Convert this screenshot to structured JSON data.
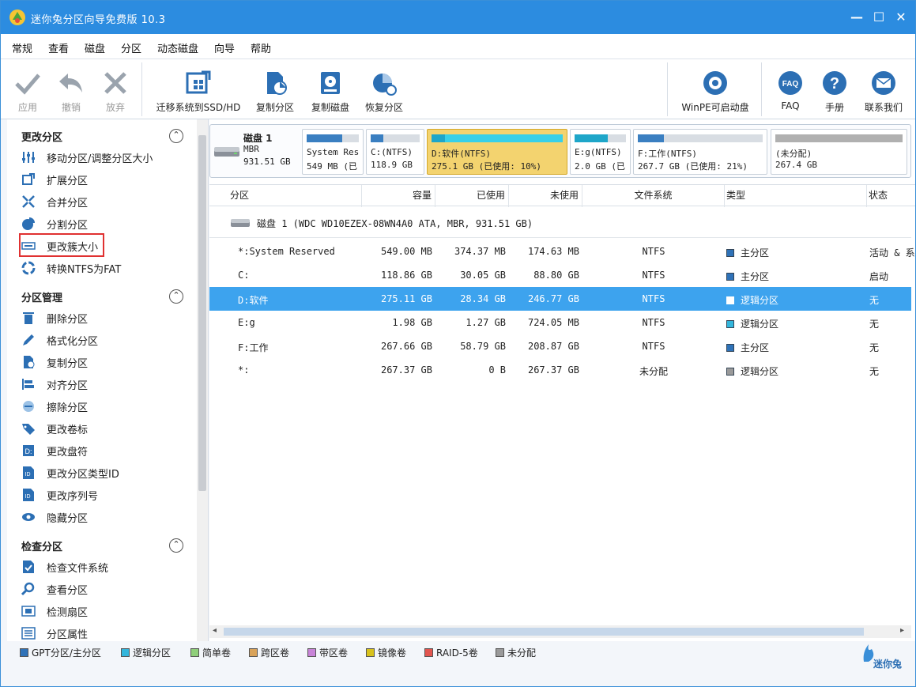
{
  "window": {
    "title": "迷你兔分区向导免费版 10.3",
    "minimize": "—",
    "maximize": "☐",
    "close": "✕"
  },
  "menu": [
    "常规",
    "查看",
    "磁盘",
    "分区",
    "动态磁盘",
    "向导",
    "帮助"
  ],
  "toolbar": {
    "apply": "应用",
    "undo": "撤销",
    "discard": "放弃",
    "migrate": "迁移系统到SSD/HD",
    "copy_partition": "复制分区",
    "copy_disk": "复制磁盘",
    "recover_partition": "恢复分区",
    "winpe": "WinPE可启动盘",
    "faq": "FAQ",
    "manual": "手册",
    "contact": "联系我们"
  },
  "sidebar": {
    "sections": [
      {
        "title": "更改分区",
        "items": [
          "移动分区/调整分区大小",
          "扩展分区",
          "合并分区",
          "分割分区",
          "更改簇大小",
          "转换NTFS为FAT"
        ]
      },
      {
        "title": "分区管理",
        "items": [
          "删除分区",
          "格式化分区",
          "复制分区",
          "对齐分区",
          "擦除分区",
          "更改卷标",
          "更改盘符",
          "更改分区类型ID",
          "更改序列号",
          "隐藏分区"
        ]
      },
      {
        "title": "检查分区",
        "items": [
          "检查文件系统",
          "查看分区",
          "检测扇区",
          "分区属性"
        ]
      }
    ],
    "toggle": "⌃"
  },
  "diskmap": {
    "disk": {
      "name": "磁盘 1",
      "type": "MBR",
      "size": "931.51 GB"
    },
    "partitions": [
      {
        "l1": "System Res",
        "l2": "549 MB (已",
        "fill": 0.68,
        "color": "#3a7fc1"
      },
      {
        "l1": "C:(NTFS)",
        "l2": "118.9 GB",
        "fill": 0.25,
        "color": "#3a7fc1"
      },
      {
        "l1": "D:软件(NTFS)",
        "l2": "275.1 GB (已使用: 10%)",
        "fill": 0.1,
        "color": "#1ea6c9"
      },
      {
        "l1": "E:g(NTFS)",
        "l2": "2.0 GB (已",
        "fill": 0.64,
        "color": "#1ea6c9"
      },
      {
        "l1": "F:工作(NTFS)",
        "l2": "267.7 GB (已使用: 21%)",
        "fill": 0.21,
        "color": "#3a7fc1"
      },
      {
        "l1": "(未分配)",
        "l2": "267.4 GB",
        "fill": 1.0,
        "color": "#b0b0b0"
      }
    ]
  },
  "table": {
    "headers": [
      "分区",
      "容量",
      "已使用",
      "未使用",
      "文件系统",
      "类型",
      "状态"
    ],
    "disk_row": "磁盘 1 (WDC WD10EZEX-08WN4A0 ATA, MBR, 931.51 GB)",
    "rows": [
      {
        "partition": "*:System Reserved",
        "capacity": "549.00 MB",
        "used": "374.37 MB",
        "unused": "174.63 MB",
        "fs": "NTFS",
        "type": "主分区",
        "status": "活动 & 系",
        "type_color": "#2f72b8"
      },
      {
        "partition": "C:",
        "capacity": "118.86 GB",
        "used": "30.05 GB",
        "unused": "88.80 GB",
        "fs": "NTFS",
        "type": "主分区",
        "status": "启动",
        "type_color": "#2f72b8"
      },
      {
        "partition": "D:软件",
        "capacity": "275.11 GB",
        "used": "28.34 GB",
        "unused": "246.77 GB",
        "fs": "NTFS",
        "type": "逻辑分区",
        "status": "无",
        "type_color": "#33b6dc"
      },
      {
        "partition": "E:g",
        "capacity": "1.98 GB",
        "used": "1.27 GB",
        "unused": "724.05 MB",
        "fs": "NTFS",
        "type": "逻辑分区",
        "status": "无",
        "type_color": "#33b6dc"
      },
      {
        "partition": "F:工作",
        "capacity": "267.66 GB",
        "used": "58.79 GB",
        "unused": "208.87 GB",
        "fs": "NTFS",
        "type": "主分区",
        "status": "无",
        "type_color": "#2f72b8"
      },
      {
        "partition": "*:",
        "capacity": "267.37 GB",
        "used": "0 B",
        "unused": "267.37 GB",
        "fs": "未分配",
        "type": "逻辑分区",
        "status": "无",
        "type_color": "#9a9a9a"
      }
    ]
  },
  "legend": [
    {
      "label": "GPT分区/主分区",
      "color": "#2f72b8"
    },
    {
      "label": "逻辑分区",
      "color": "#33b6dc"
    },
    {
      "label": "简单卷",
      "color": "#8fcf7a"
    },
    {
      "label": "跨区卷",
      "color": "#d9a35a"
    },
    {
      "label": "带区卷",
      "color": "#c884d8"
    },
    {
      "label": "镜像卷",
      "color": "#d8c21c"
    },
    {
      "label": "RAID-5卷",
      "color": "#e2554f"
    },
    {
      "label": "未分配",
      "color": "#9a9a9a"
    }
  ],
  "brand": "迷你兔"
}
